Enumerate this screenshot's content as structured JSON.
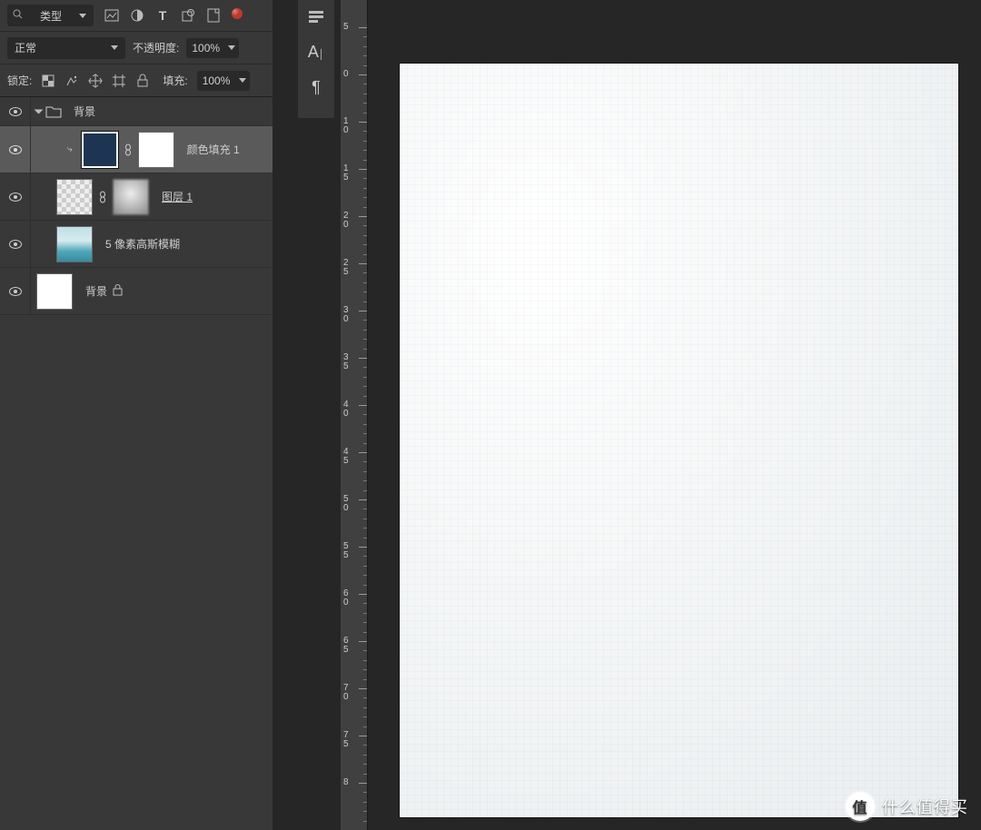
{
  "panel": {
    "filter_label": "类型",
    "blend_mode": "正常",
    "opacity_label": "不透明度:",
    "opacity_value": "100%",
    "lock_label": "锁定:",
    "fill_label": "填充:",
    "fill_value": "100%"
  },
  "group": {
    "name": "背景"
  },
  "layers": [
    {
      "name": "颜色填充 1",
      "selected": true,
      "clipped": true
    },
    {
      "name": "图层 1",
      "selected": false
    },
    {
      "name": "5 像素高斯模糊",
      "selected": false
    },
    {
      "name": "背景",
      "selected": false,
      "locked": true
    }
  ],
  "ruler": {
    "majors": [
      "5",
      "0",
      "1 0",
      "1 5",
      "2 0",
      "2 5",
      "3 0",
      "3 5",
      "4 0",
      "4 5",
      "5 0",
      "5 5",
      "6 0",
      "6 5",
      "7 0",
      "7 5",
      "8"
    ]
  },
  "watermark": {
    "badge": "值",
    "text": "什么值得买"
  }
}
